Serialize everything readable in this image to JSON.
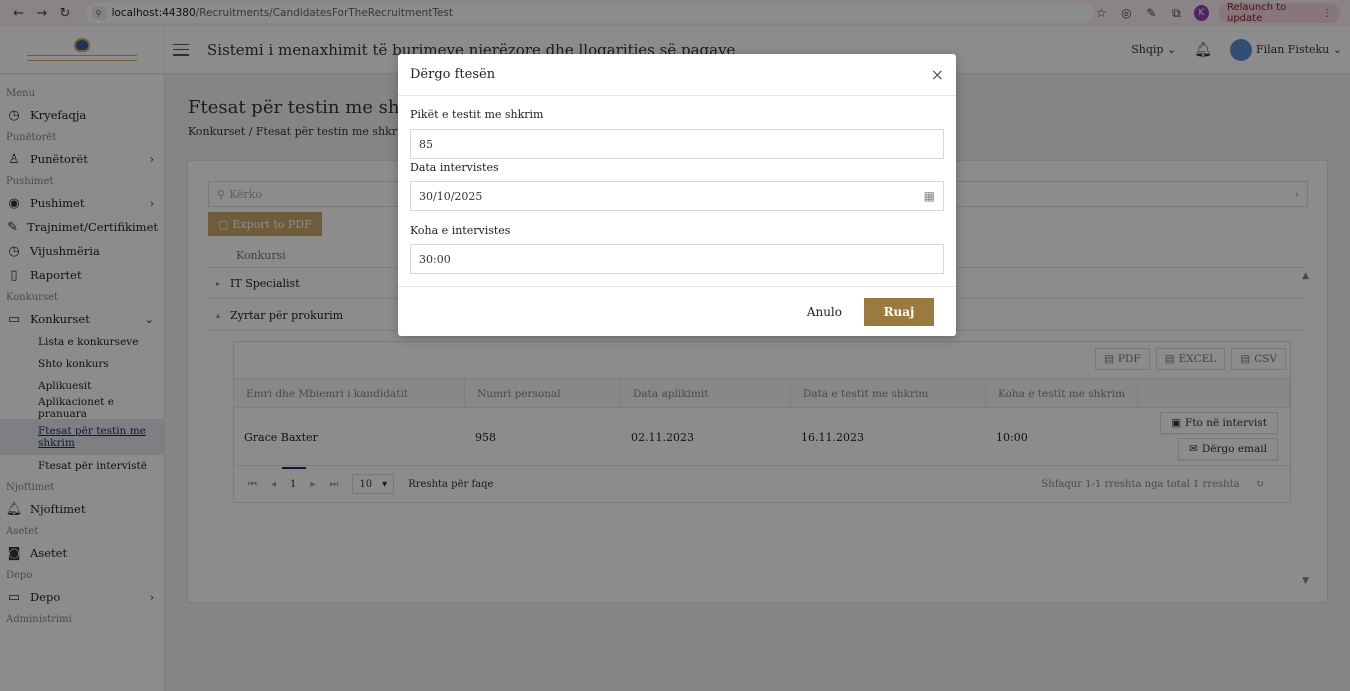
{
  "browser": {
    "url_host": "localhost:44380",
    "url_path": "/Recruitments/CandidatesForTheRecruitmentTest",
    "relaunch_label": "Relaunch to update",
    "profile_initial": "K"
  },
  "header": {
    "title": "Sistemi i menaxhimit të burimeve njerëzore dhe llogaritjes së pagave",
    "language": "Shqip",
    "user_name": "Filan Fisteku"
  },
  "sidebar": {
    "sec_menu": "Menu",
    "home": "Kryefaqja",
    "sec_employees": "Punëtorët",
    "employees": "Punëtorët",
    "sec_leave": "Pushimet",
    "leave": "Pushimet",
    "trainings": "Trajnimet/Certifikimet",
    "attendance": "Vijushmëria",
    "reports": "Raportet",
    "sec_contests": "Konkurset",
    "contests": "Konkurset",
    "sub": [
      "Lista e konkurseve",
      "Shto konkurs",
      "Aplikuesit",
      "Aplikacionet e pranuara",
      "Ftesat për testin me shkrim",
      "Ftesat për intervistë"
    ],
    "sec_notifications": "Njoftimet",
    "notifications": "Njoftimet",
    "sec_assets": "Asetet",
    "assets": "Asetet",
    "sec_depot": "Depo",
    "depot": "Depo",
    "sec_admin": "Administrimi"
  },
  "main": {
    "page_title": "Ftesat për testin me shkrim",
    "breadcrumb": "Konkurset  /  Ftesat për testin me shkrim",
    "search_placeholder": "Kërko",
    "export_label": "Export to PDF",
    "outer_column": "Konkursi",
    "groups": [
      "IT Specialist",
      "Zyrtar për prokurim"
    ]
  },
  "inner_table": {
    "tools": [
      "PDF",
      "EXCEL",
      "CSV"
    ],
    "columns": [
      "Emri dhe Mbiemri i kandidatit",
      "Numri personal",
      "Data aplikimit",
      "Data e testit me shkrim",
      "Koha e testit me shkrim"
    ],
    "rows": [
      {
        "name": "Grace Baxter",
        "personal_number": "958",
        "application_date": "02.11.2023",
        "test_date": "16.11.2023",
        "test_time": "10:00"
      }
    ],
    "actions": [
      "Fto në intervist",
      "Dërgo email"
    ],
    "pager": {
      "page": "1",
      "per_page": "10",
      "per_page_label": "Rreshta për faqe",
      "info": "Shfaqur 1-1 rreshta nga total 1 rreshta"
    }
  },
  "modal": {
    "title": "Dërgo ftesën",
    "field1_label": "Pikët e testit me shkrim",
    "field1_value": "85",
    "field2_label": "Data intervistes",
    "field2_value": "30/10/2025",
    "field3_label": "Koha e intervistes",
    "field3_value": "30:00",
    "cancel_label": "Anulo",
    "save_label": "Ruaj"
  },
  "colors": {
    "accent": "#9b7a3f",
    "export_bg": "#c9a86a",
    "active_nav": "#1a2c6b"
  }
}
